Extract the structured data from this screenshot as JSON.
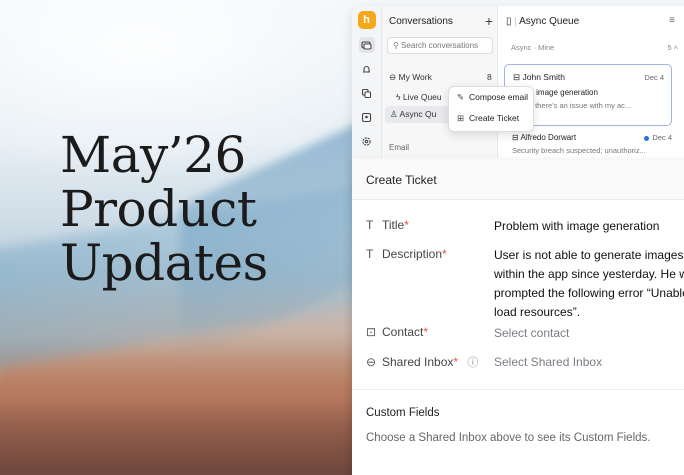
{
  "headline": [
    "May’26",
    "Product",
    "Updates"
  ],
  "rail": {
    "logo": "h"
  },
  "conversations": {
    "title": "Conversations",
    "add": "+",
    "search_placeholder": "Search conversations",
    "my_work": {
      "label": "My Work",
      "count": "8"
    },
    "live_queue": "Live Queu",
    "async_queue": "Async Qu",
    "email_section": "Email"
  },
  "queue": {
    "title": "Async Queue",
    "subtitle": "Async · Mine",
    "count": "5",
    "items": [
      {
        "name": "John Smith",
        "date": "Dec 4",
        "subject": "e with image generation",
        "preview": "I think there's an issue with my ac..."
      },
      {
        "name": "Alfredo Dorwart",
        "date": "Dec 4",
        "preview": "Security breach suspected; unauthoriz..."
      }
    ]
  },
  "context_menu": {
    "compose": "Compose email",
    "create": "Create Ticket"
  },
  "ticket": {
    "header": "Create Ticket",
    "title_label": "Title",
    "title_value": "Problem with image generation",
    "description_label": "Description",
    "description_lines": [
      "User is not able to generate images",
      "within the app since yesterday. He wa",
      "prompted the following error “Unable",
      "load resources”."
    ],
    "contact_label": "Contact",
    "contact_value": "Select contact",
    "inbox_label": "Shared Inbox",
    "inbox_value": "Select Shared Inbox",
    "required_mark": "*",
    "custom_fields_title": "Custom Fields",
    "custom_fields_text": "Choose a Shared Inbox above to see its Custom Fields."
  }
}
